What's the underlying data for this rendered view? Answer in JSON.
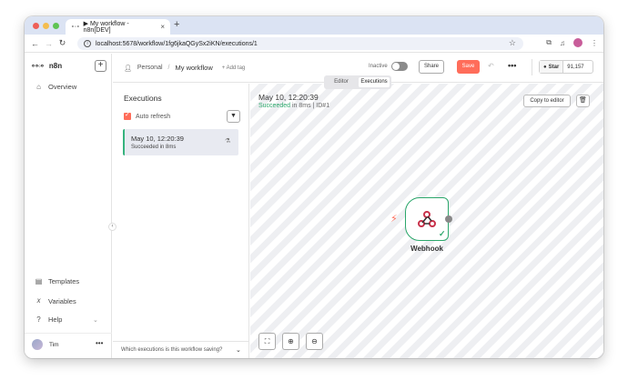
{
  "browser": {
    "tab_title": "▶ My workflow - n8n[DEV]",
    "tab_close": "×",
    "new_tab": "+",
    "url": "localhost:5678/workflow/1fg6jkaQGySx2iKN/executions/1"
  },
  "sidebar": {
    "brand": "n8n",
    "items": [
      {
        "label": "Overview",
        "icon": "home-icon"
      },
      {
        "label": "Templates",
        "icon": "templates-icon"
      },
      {
        "label": "Variables",
        "icon": "variables-icon"
      },
      {
        "label": "Help",
        "icon": "help-icon"
      }
    ],
    "user_name": "Tim"
  },
  "topbar": {
    "project": "Personal",
    "workflow_name": "My workflow",
    "add_tag": "+ Add tag",
    "active_status": "Inactive",
    "share_label": "Share",
    "save_label": "Save",
    "github_label": "Star",
    "github_count": "91,157"
  },
  "executions": {
    "title": "Executions",
    "auto_refresh_label": "Auto refresh",
    "auto_refresh_checked": true,
    "list": [
      {
        "date": "May 10, 12:20:39",
        "status": "Succeeded in 8ms"
      }
    ],
    "footer_question": "Which executions is this workflow saving?"
  },
  "canvas": {
    "modes": [
      "Editor",
      "Executions"
    ],
    "active_mode": "Executions",
    "execution_date": "May 10, 12:20:39",
    "status_word": "Succeeded",
    "status_rest": " in 8ms | ID#1",
    "copy_label": "Copy to editor",
    "node_label": "Webhook"
  },
  "colors": {
    "accent": "#ff6d5a",
    "success": "#2ca76b"
  }
}
